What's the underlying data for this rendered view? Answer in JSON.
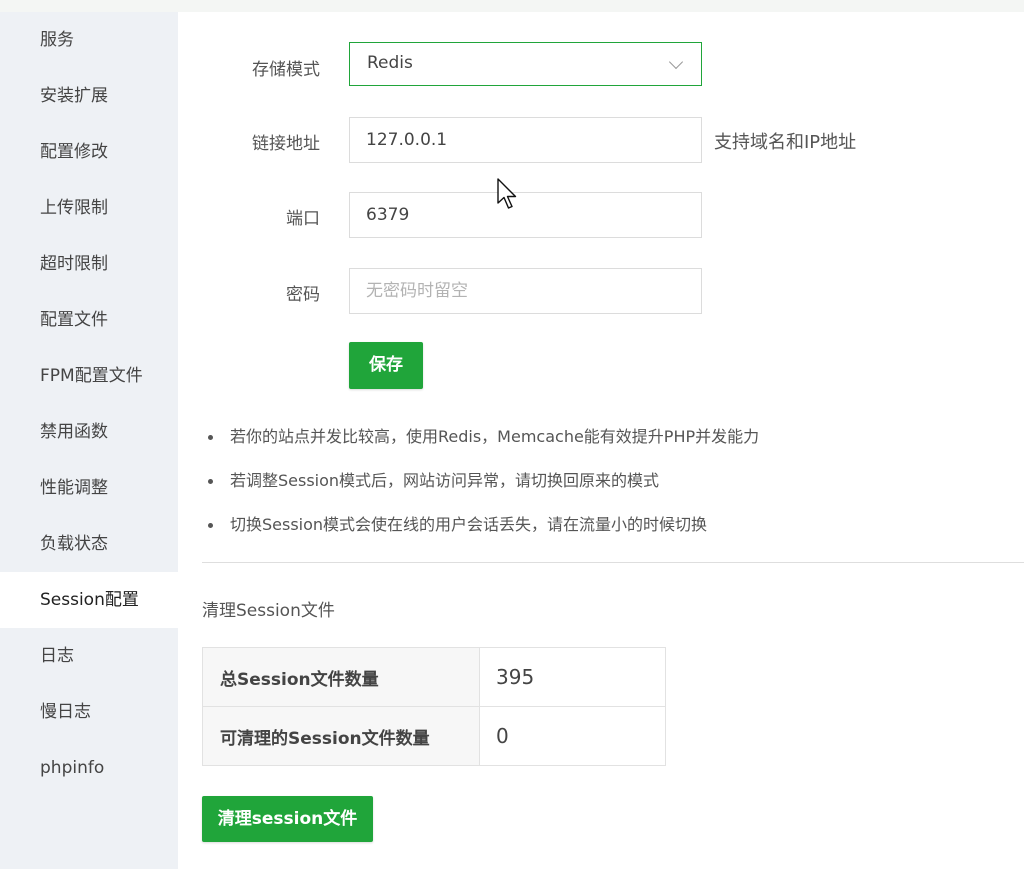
{
  "sidebar": {
    "items": [
      {
        "label": "服务",
        "active": false
      },
      {
        "label": "安装扩展",
        "active": false
      },
      {
        "label": "配置修改",
        "active": false
      },
      {
        "label": "上传限制",
        "active": false
      },
      {
        "label": "超时限制",
        "active": false
      },
      {
        "label": "配置文件",
        "active": false
      },
      {
        "label": "FPM配置文件",
        "active": false
      },
      {
        "label": "禁用函数",
        "active": false
      },
      {
        "label": "性能调整",
        "active": false
      },
      {
        "label": "负载状态",
        "active": false
      },
      {
        "label": "Session配置",
        "active": true
      },
      {
        "label": "日志",
        "active": false
      },
      {
        "label": "慢日志",
        "active": false
      },
      {
        "label": "phpinfo",
        "active": false
      }
    ]
  },
  "form": {
    "storage_mode": {
      "label": "存储模式",
      "value": "Redis"
    },
    "host": {
      "label": "链接地址",
      "value": "127.0.0.1",
      "hint": "支持域名和IP地址"
    },
    "port": {
      "label": "端口",
      "value": "6379"
    },
    "password": {
      "label": "密码",
      "value": "",
      "placeholder": "无密码时留空"
    },
    "save_label": "保存"
  },
  "tips": [
    "若你的站点并发比较高，使用Redis，Memcache能有效提升PHP并发能力",
    "若调整Session模式后，网站访问异常，请切换回原来的模式",
    "切换Session模式会使在线的用户会话丢失，请在流量小的时候切换"
  ],
  "cleanup": {
    "title": "清理Session文件",
    "rows": [
      {
        "key": "总Session文件数量",
        "value": "395"
      },
      {
        "key": "可清理的Session文件数量",
        "value": "0"
      }
    ],
    "button_label": "清理session文件"
  },
  "colors": {
    "accent": "#20a53a",
    "sidebar_bg": "#eef1f5"
  }
}
